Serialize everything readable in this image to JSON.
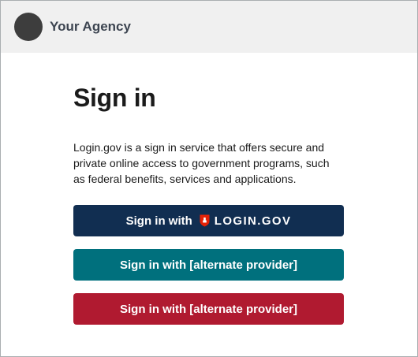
{
  "header": {
    "agency_name": "Your Agency"
  },
  "main": {
    "title": "Sign in",
    "description": "Login.gov is a sign in service that offers secure and private online access to government programs, such as federal benefits, services and applications.",
    "buttons": {
      "login_gov": {
        "prefix": "Sign in with",
        "brand": "LOGIN.GOV"
      },
      "alternate_1": {
        "label": "Sign in with [alternate provider]"
      },
      "alternate_2": {
        "label": "Sign in with [alternate provider]"
      }
    }
  },
  "colors": {
    "header_bg": "#f0f0f0",
    "login_gov_button": "#112e51",
    "alternate_1_button": "#00707d",
    "alternate_2_button": "#b01a30",
    "shield": "#e52207"
  }
}
